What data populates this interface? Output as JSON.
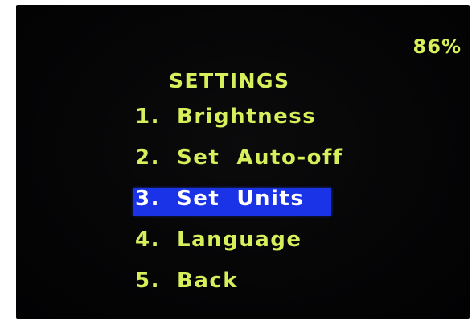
{
  "status": {
    "battery": "86%"
  },
  "menu": {
    "title": "SETTINGS",
    "items": [
      {
        "number": "1.",
        "label": "Brightness",
        "selected": false
      },
      {
        "number": "2.",
        "label": "Set  Auto-off",
        "selected": false
      },
      {
        "number": "3.",
        "label": "Set  Units",
        "selected": true
      },
      {
        "number": "4.",
        "label": "Language",
        "selected": false
      },
      {
        "number": "5.",
        "label": "Back",
        "selected": false
      }
    ]
  },
  "colors": {
    "text": "#d8ef5c",
    "highlight": "#1a33e6",
    "highlight_text": "#ffffff",
    "background": "#050506"
  }
}
